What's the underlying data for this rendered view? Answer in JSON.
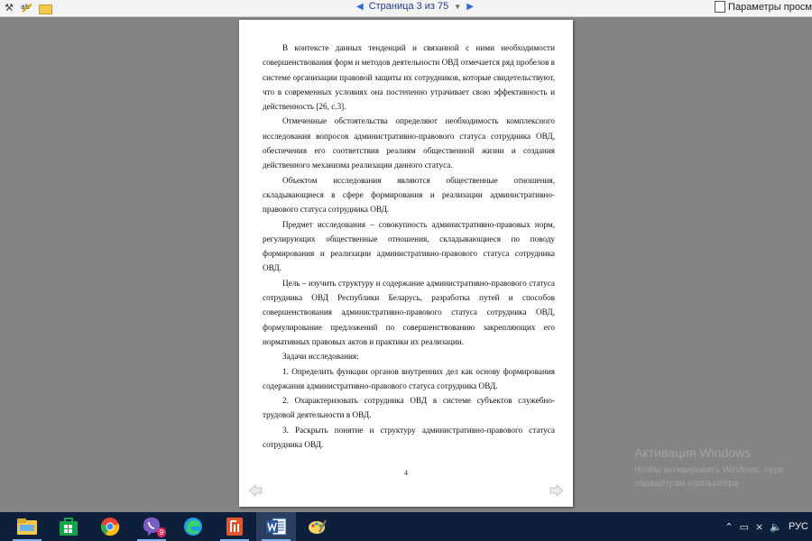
{
  "toolbar": {
    "icons": [
      "tools-icon",
      "spellcheck-icon",
      "folder-icon"
    ],
    "pager_text": "Страница 3 из 75",
    "view_options_label": "Параметры просм"
  },
  "document": {
    "paragraphs": [
      "В контексте данных тенденций и связанной с ними необходимости совершенствования форм и методов деятельности ОВД отмечается ряд пробелов в системе организации правовой защиты их сотрудников, которые свидетельствуют, что в современных условиях она постепенно утрачивает свою эффективность и действенность [26, с.3].",
      "Отмеченные обстоятельства определяют необходимость комплексного исследования вопросов административно-правового статуса сотрудника ОВД, обеспечения его соответствия реалиям общественной жизни и создания действенного механизма реализации данного статуса.",
      "Объектом исследования являются общественные отношения, складывающиеся в сфере формирования и реализации административно-правового статуса сотрудника ОВД.",
      "Предмет исследования – совокупность административно-правовых норм, регулирующих общественные отношения, складывающиеся по поводу формирования и реализации административно-правового статуса сотрудника ОВД.",
      "Цель – изучить структуру и содержание административно-правового статуса сотрудника ОВД Республики Беларусь, разработка путей и способов совершенствования административно-правового статуса сотрудника ОВД, формулирование предложений по совершенствованию закрепляющих его нормативных правовых актов и практики их реализации.",
      "Задачи исследования:",
      "1. Определить функции органов внутренних дел как основу формирования содержания административно-правового статуса сотрудника ОВД.",
      "2. Охарактеризовать сотрудника ОВД в системе субъектов служебно-трудовой деятельности в ОВД.",
      "3. Раскрыть понятие и структуру административно-правового статуса сотрудника ОВД."
    ],
    "page_number": "4"
  },
  "watermark": {
    "title": "Активация Windows",
    "line1": "Чтобы активировать Windows, пере",
    "line2": "параметрам компьютера"
  },
  "taskbar": {
    "apps": [
      {
        "name": "file-explorer-icon",
        "color": "#f2c94c"
      },
      {
        "name": "store-icon",
        "color": "#16a34a"
      },
      {
        "name": "chrome-icon",
        "color": "#ea4335"
      },
      {
        "name": "viber-icon",
        "color": "#7c5cc4",
        "badge": "9"
      },
      {
        "name": "edge-icon",
        "color": "#1ea0e0"
      },
      {
        "name": "pdf-reader-icon",
        "color": "#e2572b"
      },
      {
        "name": "word-icon",
        "color": "#2b579a"
      },
      {
        "name": "paint-icon",
        "color": "#f0b400"
      }
    ],
    "lang": "РУС"
  }
}
